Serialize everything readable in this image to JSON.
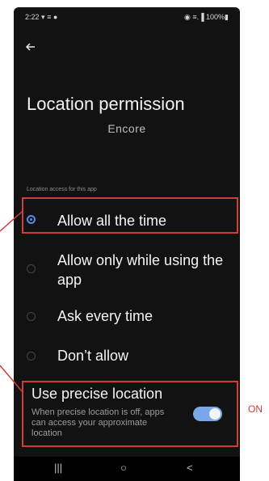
{
  "status_bar": {
    "time": "2:22",
    "indicators": "▾ ≡ ●",
    "right": "◉ ≡.▐ 100%▮"
  },
  "header": {
    "title": "Location permission",
    "subtitle": "Encore"
  },
  "section": {
    "label": "Location access for this app"
  },
  "options": [
    {
      "label": "Allow all the time",
      "selected": true
    },
    {
      "label": "Allow only while using the app",
      "selected": false
    },
    {
      "label": "Ask every time",
      "selected": false
    },
    {
      "label": "Don’t allow",
      "selected": false
    }
  ],
  "precise": {
    "title": "Use precise location",
    "description": "When precise location is off, apps can access your approximate location",
    "enabled": true
  },
  "navbar": {
    "recents": "|||",
    "home": "○",
    "back": "<"
  },
  "annotation": {
    "on_label": "ON"
  },
  "colors": {
    "highlight": "#d43b3b",
    "accent": "#4f8cf0",
    "toggle": "#7aa7ea",
    "background": "#121212"
  }
}
